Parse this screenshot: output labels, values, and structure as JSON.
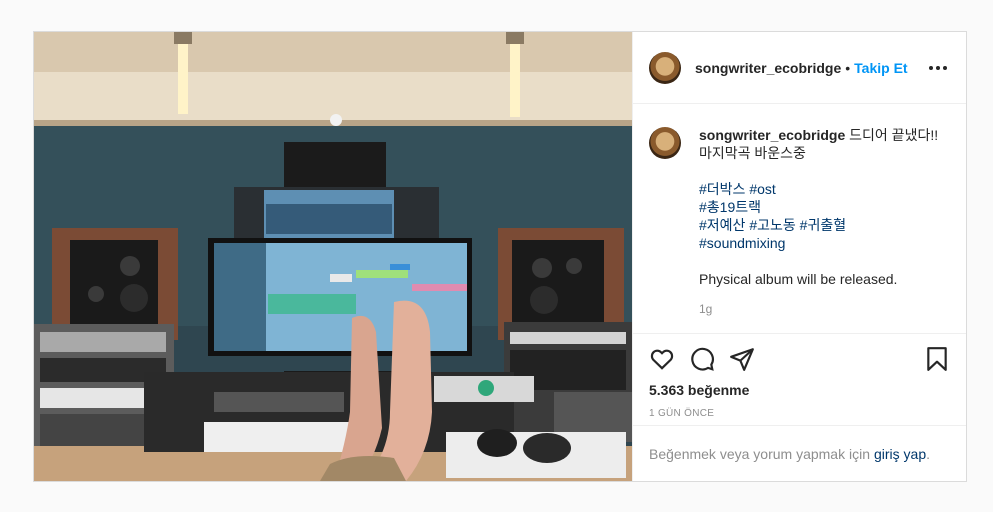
{
  "post": {
    "username": "songwriter_ecobridge",
    "separator": "•",
    "follow_label": "Takip Et",
    "caption": {
      "username": "songwriter_ecobridge",
      "line1": "드디어 끝냈다!!",
      "line2": "마지막곡 바운스중",
      "hashtag_lines": [
        [
          "#더박스",
          "#ost"
        ],
        [
          "#총19트랙"
        ],
        [
          "#저예산",
          "#고노동",
          "#귀출혈"
        ],
        [
          "#soundmixing"
        ]
      ],
      "extra": "Physical album will be released.",
      "time": "1g"
    },
    "likes": "5.363 beğenme",
    "posted_ago": "1 GÜN ÖNCE",
    "login_prompt": "Beğenmek veya yorum yapmak için",
    "login_link": "giriş yap",
    "login_period": "."
  },
  "icons": {
    "more": "more-options-icon",
    "like": "heart-icon",
    "comment": "comment-icon",
    "share": "share-icon",
    "save": "bookmark-icon"
  },
  "colors": {
    "follow": "#0095f6",
    "hashtag": "#00376b",
    "muted": "#8e8e8e"
  }
}
